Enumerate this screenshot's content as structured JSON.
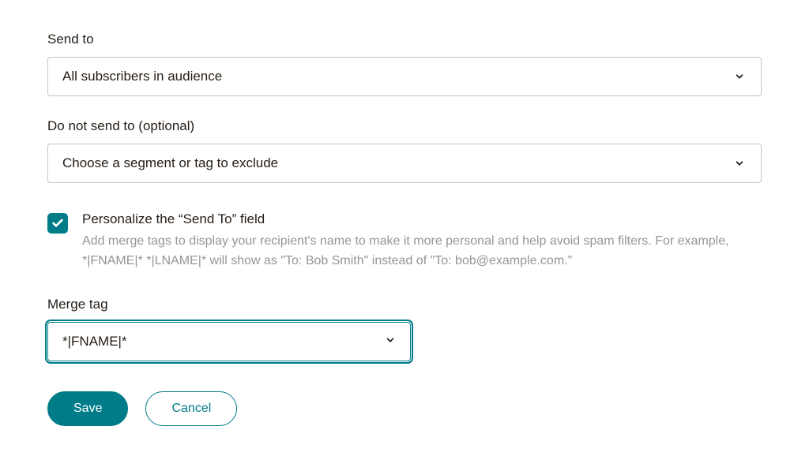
{
  "sendTo": {
    "label": "Send to",
    "selected": "All subscribers in audience"
  },
  "doNotSendTo": {
    "label": "Do not send to (optional)",
    "selected": "Choose a segment or tag to exclude"
  },
  "personalize": {
    "checked": true,
    "title": "Personalize the “Send To” field",
    "help": "Add merge tags to display your recipient's name to make it more personal and help avoid spam filters. For example, *|FNAME|* *|LNAME|* will show as \"To: Bob Smith\" instead of \"To: bob@example.com.\""
  },
  "mergeTag": {
    "label": "Merge tag",
    "selected": "*|FNAME|*"
  },
  "buttons": {
    "save": "Save",
    "cancel": "Cancel"
  }
}
